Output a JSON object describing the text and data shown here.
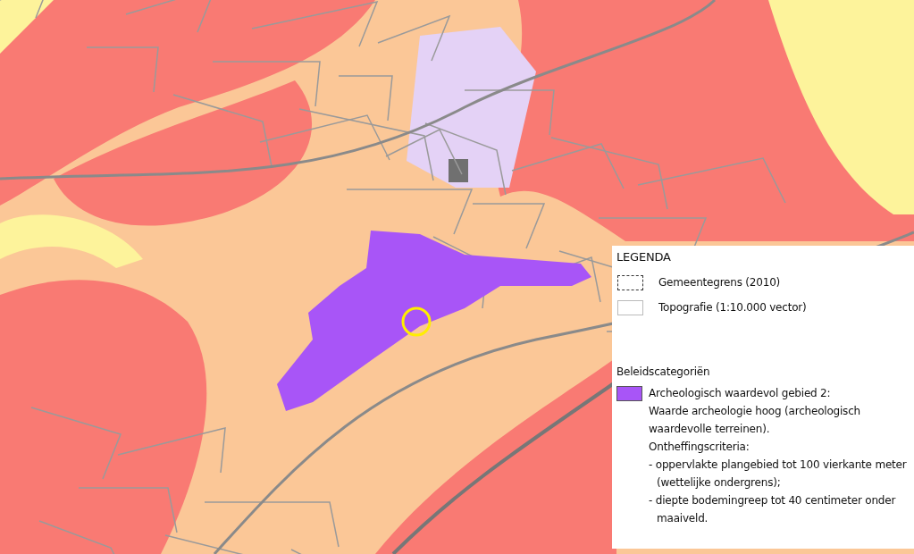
{
  "legend": {
    "title": "LEGENDA",
    "items": [
      {
        "kind": "boundary",
        "label": "Gemeentegrens (2010)"
      },
      {
        "kind": "topography",
        "label": "Topografie (1:10.000 vector)"
      }
    ],
    "section_title": "Beleidscategoriën",
    "categories": [
      {
        "color": "#a855f7",
        "title": "Archeologisch waardevol gebied 2:",
        "description": "Waarde archeologie hoog (archeologisch waardevolle terreinen).",
        "criteria_heading": "Ontheffingscriteria:",
        "criteria": [
          "- oppervlakte plangebied tot 100 vierkante meter (wettelijke ondergrens);",
          "- diepte bodemingreep tot 40 centimeter onder maaiveld."
        ]
      }
    ]
  }
}
